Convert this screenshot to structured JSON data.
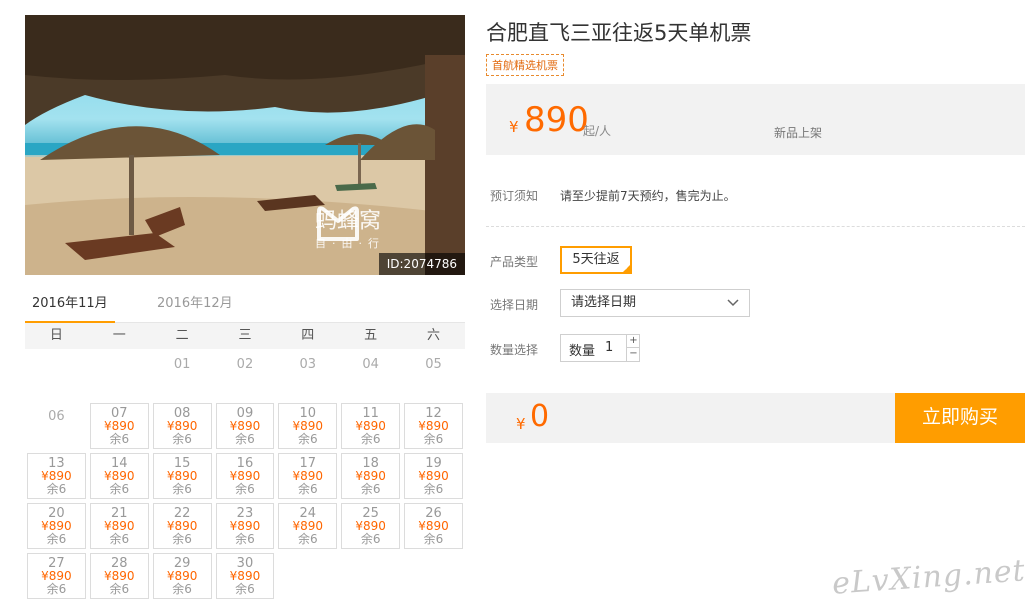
{
  "product": {
    "title": "合肥直飞三亚往返5天单机票",
    "badge": "首航精选机票",
    "photo_id": "ID:2074786",
    "watermark_text": "蚂蜂窝",
    "watermark_sub": "自·由·行"
  },
  "price": {
    "currency": "¥",
    "value": "890",
    "unit": "起/人",
    "note": "新品上架"
  },
  "booking": {
    "notice_label": "预订须知",
    "notice_text": "请至少提前7天预约，售完为止。",
    "type_label": "产品类型",
    "type_value": "5天往返",
    "date_label": "选择日期",
    "date_placeholder": "请选择日期",
    "qty_label": "数量选择",
    "qty_inner_label": "数量",
    "qty_value": "1",
    "qty_plus": "+",
    "qty_minus": "−"
  },
  "total": {
    "currency": "¥",
    "value": "0",
    "buy_label": "立即购买"
  },
  "calendar": {
    "tabs": [
      "2016年11月",
      "2016年12月"
    ],
    "active_tab": 0,
    "weekdays": [
      "日",
      "一",
      "二",
      "三",
      "四",
      "五",
      "六"
    ],
    "price_text": "¥890",
    "stock_text": "余6",
    "rows": [
      [
        null,
        null,
        {
          "d": "01"
        },
        {
          "d": "02"
        },
        {
          "d": "03"
        },
        {
          "d": "04"
        },
        {
          "d": "05"
        }
      ],
      [
        {
          "d": "06"
        },
        {
          "d": "07",
          "a": 1
        },
        {
          "d": "08",
          "a": 1
        },
        {
          "d": "09",
          "a": 1
        },
        {
          "d": "10",
          "a": 1
        },
        {
          "d": "11",
          "a": 1
        },
        {
          "d": "12",
          "a": 1
        }
      ],
      [
        {
          "d": "13",
          "a": 1
        },
        {
          "d": "14",
          "a": 1
        },
        {
          "d": "15",
          "a": 1
        },
        {
          "d": "16",
          "a": 1
        },
        {
          "d": "17",
          "a": 1
        },
        {
          "d": "18",
          "a": 1
        },
        {
          "d": "19",
          "a": 1
        }
      ],
      [
        {
          "d": "20",
          "a": 1
        },
        {
          "d": "21",
          "a": 1
        },
        {
          "d": "22",
          "a": 1
        },
        {
          "d": "23",
          "a": 1
        },
        {
          "d": "24",
          "a": 1
        },
        {
          "d": "25",
          "a": 1
        },
        {
          "d": "26",
          "a": 1
        }
      ],
      [
        {
          "d": "27",
          "a": 1
        },
        {
          "d": "28",
          "a": 1
        },
        {
          "d": "29",
          "a": 1
        },
        {
          "d": "30",
          "a": 1
        },
        null,
        null,
        null
      ]
    ]
  },
  "site_watermark": "eLvXing.net",
  "colors": {
    "accent": "#ff9d00",
    "price": "#ff6a00"
  }
}
